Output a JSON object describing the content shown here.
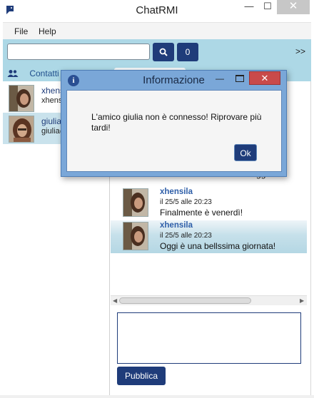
{
  "window": {
    "title": "ChatRMI",
    "minimize_glyph": "—",
    "maximize_glyph": "☐",
    "close_glyph": "✕"
  },
  "menu": {
    "file": "File",
    "help": "Help"
  },
  "toolbar": {
    "search_value": "",
    "search_icon": "search-icon",
    "count": "0",
    "expand": ">>"
  },
  "tabs": {
    "contacts_label": "Contatti"
  },
  "contacts": [
    {
      "name": "xhens",
      "mail": "xhensi"
    },
    {
      "name": "giulia",
      "mail": "giulia@"
    }
  ],
  "messages": {
    "partial_text": "Ma che bel sole che c'è oggi!!",
    "items": [
      {
        "author": "xhensila",
        "date": "il 25/5 alle 20:23",
        "text": "Finalmente è venerdì!"
      },
      {
        "author": "xhensila",
        "date": "il 25/5 alle 20:23",
        "text": "Oggi è una bellssima giornata!"
      }
    ]
  },
  "compose": {
    "publish_label": "Pubblica"
  },
  "dialog": {
    "title": "Informazione",
    "message": "L'amico giulia non è connesso! Riprovare più tardi!",
    "ok_label": "Ok",
    "close_glyph": "✕",
    "min_glyph": "—",
    "icon_glyph": "i"
  },
  "colors": {
    "accent": "#1f3c7a",
    "toolbar_bg": "#add8e6",
    "dialog_frame": "#7aa7d8",
    "close_red": "#c94a4a"
  }
}
